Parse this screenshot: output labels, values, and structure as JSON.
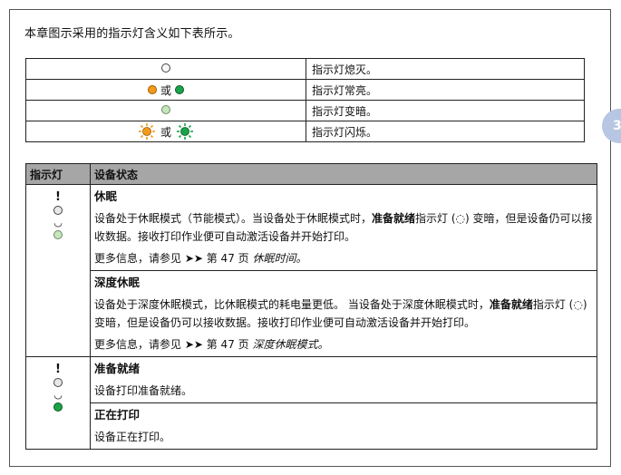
{
  "intro": "本章图示采用的指示灯含义如下表所示。",
  "side_tab": "3",
  "legend": {
    "or_word": "或",
    "rows": [
      {
        "desc": "指示灯熄灭。"
      },
      {
        "desc": "指示灯常亮。"
      },
      {
        "desc": "指示灯变暗。"
      },
      {
        "desc": "指示灯闪烁。"
      }
    ]
  },
  "status": {
    "headers": [
      "指示灯",
      "设备状态"
    ],
    "sleep": {
      "title": "休眠",
      "text1": "设备处于休眠模式（节能模式）。当设备处于休眠模式时，",
      "bold1": "准备就绪",
      "text2": "指示灯 (",
      "glyph": "◌",
      "text3": ") 变暗，但是设备仍可以接收数据。接收打印作业便可自动激活设备并开始打印。",
      "more_prefix": "更多信息，请参见 ➤➤ 第 47 页 ",
      "more_link": "休眠时间。"
    },
    "deep_sleep": {
      "title": "深度休眠",
      "text1": "设备处于深度休眠模式，比休眠模式的耗电量更低。 当设备处于深度休眠模式时，",
      "bold1": "准备就绪",
      "text2": "指示灯 (",
      "glyph": "◌",
      "text3": ") 变暗，但是设备仍可以接收数据。接收打印作业便可自动激活设备并开始打印。",
      "more_prefix": "更多信息，请参见 ➤➤ 第 47 页 ",
      "more_link": "深度休眠模式。"
    },
    "ready": {
      "title": "准备就绪",
      "text": "设备打印准备就绪。"
    },
    "printing": {
      "title": "正在打印",
      "text": "设备正在打印。"
    }
  },
  "colors": {
    "orange": "#f39a1a",
    "green": "#1aa34a",
    "dim_green": "#c8e6bd",
    "off": "#e8e8e8",
    "header_gray": "#a6a6a6",
    "tab_blue": "#b7c6e3"
  }
}
